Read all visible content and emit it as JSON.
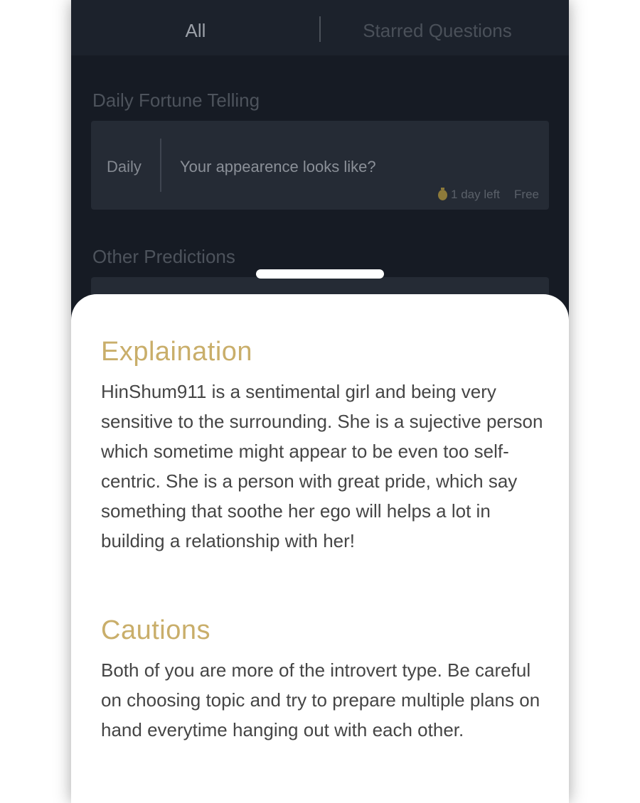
{
  "tabs": {
    "all_label": "All",
    "starred_label": "Starred Questions"
  },
  "daily": {
    "section_title": "Daily Fortune Telling",
    "card": {
      "tag": "Daily",
      "question": "Your appearence looks like?",
      "time_left": "1 day left",
      "price": "Free"
    }
  },
  "other": {
    "section_title": "Other Predictions"
  },
  "sheet": {
    "explanation_heading": "Explaination",
    "explanation_text": "HinShum911 is a sentimental girl and being very sensitive to the surrounding. She is a sujective person which sometime might appear to be even too self-centric. She is a person with great pride, which say something that soothe her ego will helps a lot in building a relationship with her!",
    "cautions_heading": "Cautions",
    "cautions_text": "Both of you are more of the introvert type. Be careful on choosing topic and try to prepare multiple plans on hand everytime hanging out with each other."
  },
  "colors": {
    "accent_gold": "#c9ae6a",
    "background_dark": "#161b24",
    "card_background": "#252b35"
  },
  "icons": {
    "time_icon": "timer-icon"
  }
}
